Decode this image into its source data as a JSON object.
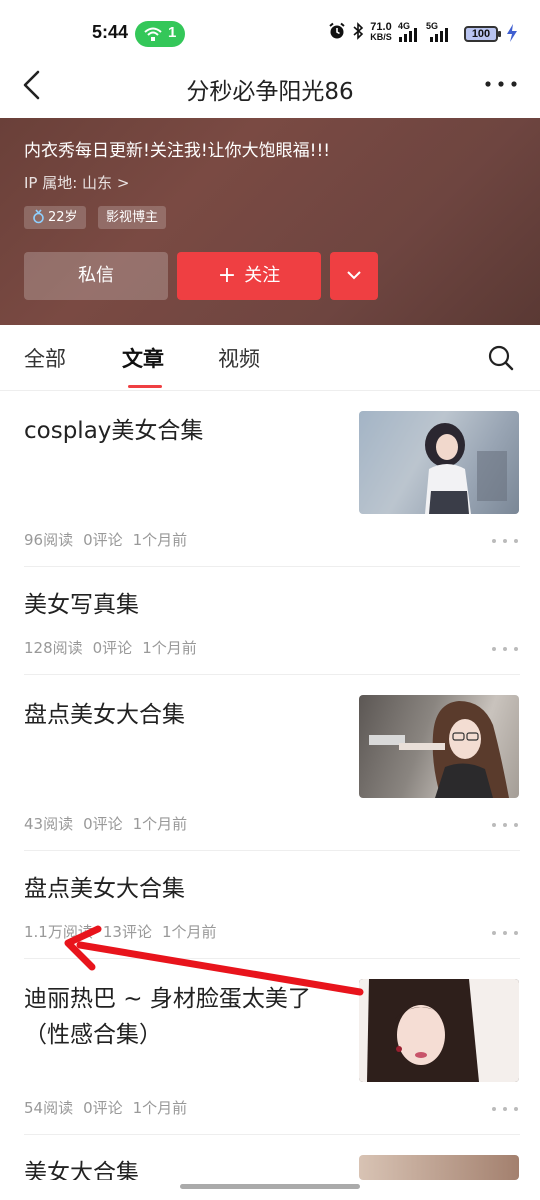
{
  "status_bar": {
    "time": "5:44",
    "hotspot_count": "1",
    "net_speed_value": "71.0",
    "net_speed_unit": "KB/S",
    "signal_4g": "4G",
    "signal_5g": "5G",
    "battery": "100"
  },
  "navbar": {
    "title": "分秒必争阳光86"
  },
  "profile": {
    "bio": "内衣秀每日更新!关注我!让你大饱眼福!!!",
    "ip_location": "IP 属地: 山东 >",
    "tags": [
      "22岁",
      "影视博主"
    ],
    "message_label": "私信",
    "follow_label": "关注"
  },
  "tabs": {
    "items": [
      "全部",
      "文章",
      "视频"
    ],
    "active": "文章"
  },
  "articles": [
    {
      "title": "cosplay美女合集",
      "reads": "96阅读",
      "comments": "0评论",
      "time": "1个月前"
    },
    {
      "title": "美女写真集",
      "reads": "128阅读",
      "comments": "0评论",
      "time": "1个月前"
    },
    {
      "title": "盘点美女大合集",
      "reads": "43阅读",
      "comments": "0评论",
      "time": "1个月前"
    },
    {
      "title": "盘点美女大合集",
      "reads": "1.1万阅读",
      "comments": "13评论",
      "time": "1个月前"
    },
    {
      "title_line1": "迪丽热巴 ~ 身材脸蛋太美了",
      "title_line2": "（性感合集）",
      "reads": "54阅读",
      "comments": "0评论",
      "time": "1个月前"
    },
    {
      "title": "美女大合集"
    }
  ],
  "colors": {
    "accent": "#ef3f42",
    "banner": "#6e4540",
    "annotation_arrow": "#e8141c"
  }
}
